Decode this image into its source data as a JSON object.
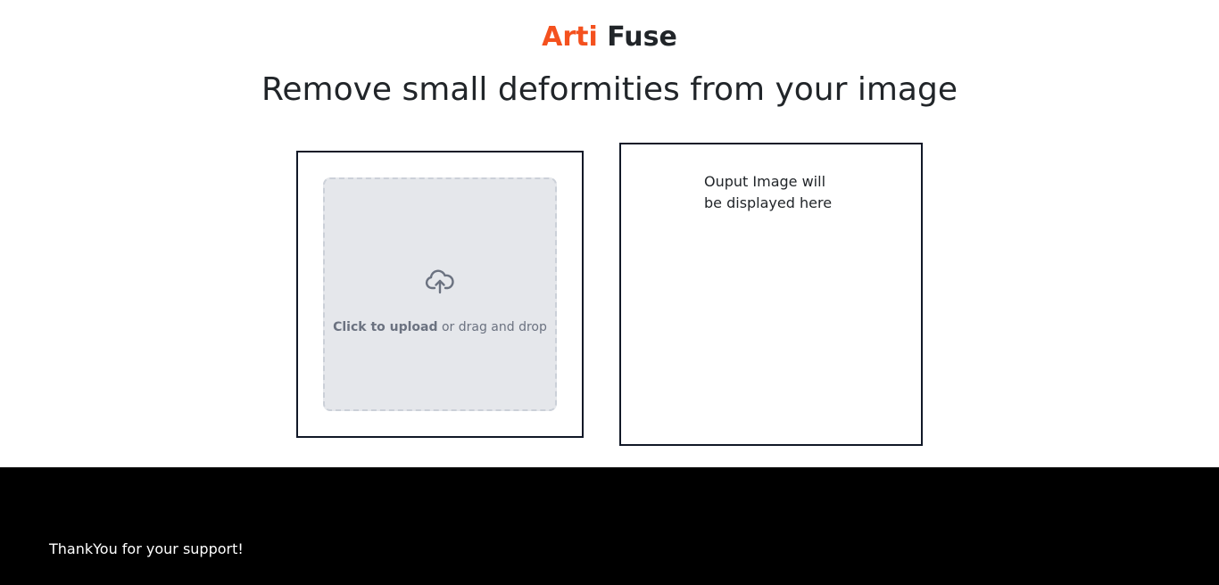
{
  "brand": {
    "accent_text": "Arti",
    "rest_text": "Fuse",
    "accent_color": "#f4511e"
  },
  "headline": "Remove small deformities from your image",
  "upload": {
    "icon": "cloud-upload-icon",
    "cta_bold": "Click to upload",
    "cta_rest": " or drag and drop"
  },
  "output": {
    "placeholder_line1": "Ouput Image will",
    "placeholder_line2": "be displayed here"
  },
  "footer": {
    "thanks": "ThankYou for your support!"
  }
}
